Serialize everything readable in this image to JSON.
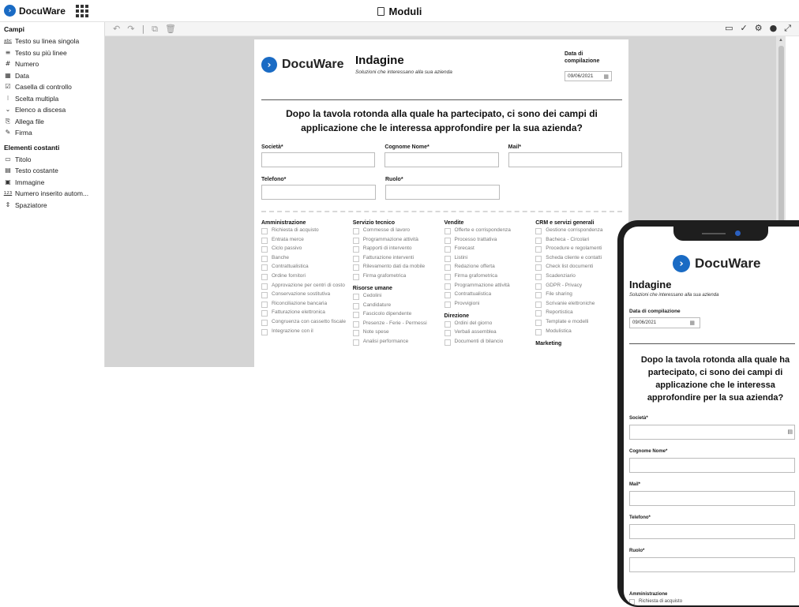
{
  "app": {
    "brand": "DocuWare",
    "title": "Moduli"
  },
  "sidebar": {
    "fields_heading": "Campi",
    "fields": [
      {
        "icon": "abc",
        "label": "Testo su linea singola"
      },
      {
        "icon": "≡",
        "label": "Testo su più linee"
      },
      {
        "icon": "#",
        "label": "Numero"
      },
      {
        "icon": "▦",
        "label": "Data"
      },
      {
        "icon": "☑",
        "label": "Casella di controllo"
      },
      {
        "icon": "⁝",
        "label": "Scelta multipla"
      },
      {
        "icon": "⌄",
        "label": "Elenco a discesa"
      },
      {
        "icon": "⎘",
        "label": "Allega file"
      },
      {
        "icon": "✎",
        "label": "Firma"
      }
    ],
    "constants_heading": "Elementi costanti",
    "constants": [
      {
        "icon": "▭",
        "label": "Titolo"
      },
      {
        "icon": "▤",
        "label": "Testo costante"
      },
      {
        "icon": "▣",
        "label": "Immagine"
      },
      {
        "icon": "123",
        "label": "Numero inserito autom..."
      },
      {
        "icon": "⇕",
        "label": "Spaziatore"
      }
    ]
  },
  "toolbar": {
    "left": [
      "↶",
      "↷",
      "|",
      "⧉",
      "🗑"
    ],
    "right": [
      "▭",
      "✓",
      "⚙",
      "●",
      "⤢"
    ]
  },
  "form": {
    "brand": "DocuWare",
    "title": "Indagine",
    "subtitle": "Soluzioni che interessano alla sua azienda",
    "date_label": "Data di compilazione",
    "date_value": "09/06/2021",
    "question": "Dopo la tavola rotonda alla quale ha partecipato, ci sono dei campi di applicazione che le interessa approfondire per la sua azienda?",
    "fields_row1": [
      "Società*",
      "Cognome Nome*",
      "Mail*"
    ],
    "fields_row2": [
      "Telefono*",
      "Ruolo*"
    ],
    "columns": [
      {
        "groups": [
          {
            "heading": "Amministrazione",
            "items": [
              "Richiesta di acquisto",
              "Entrata merce",
              "Ciclo passivo",
              "Banche",
              "Contrattualistica",
              "Ordine fornitori",
              "Approvazione per centri di costo",
              "Conservazione sostitutiva",
              "Riconciliazione bancaria",
              "Fatturazione elettronica",
              "Congruenza con cassetto fiscale",
              "Integrazione con il"
            ]
          }
        ]
      },
      {
        "groups": [
          {
            "heading": "Servizio tecnico",
            "items": [
              "Commesse di lavoro",
              "Programmazione attività",
              "Rapporti di intervento",
              "Fatturazione interventi",
              "Rilevamento dati da mobile",
              "Firma grafometrica"
            ]
          },
          {
            "heading": "Risorse umane",
            "items": [
              "Cedolini",
              "Candidature",
              "Fascicolo dipendente",
              "Presenze - Ferie - Permessi",
              "Note spese",
              "Analisi performance"
            ]
          }
        ]
      },
      {
        "groups": [
          {
            "heading": "Vendite",
            "items": [
              "Offerte e corrispondenza",
              "Processo trattativa",
              "Forecast",
              "Listini",
              "Redazione offerta",
              "Firma grafometrica",
              "Programmazione attività",
              "Contrattualistica",
              "Provvigioni"
            ]
          },
          {
            "heading": "Direzione",
            "items": [
              "Ordini del giorno",
              "Verbali assemblea",
              "Documenti di bilancio"
            ]
          }
        ]
      },
      {
        "groups": [
          {
            "heading": "CRM e servizi generali",
            "items": [
              "Gestione corrispondenza",
              "Bacheca - Circolari",
              "Procedure e regolamenti",
              "Scheda cliente e contatti",
              "Check list documenti",
              "Scadenziario",
              "GDPR - Privacy",
              "File sharing",
              "Scrivanie elettroniche",
              "Reportistica",
              "Template e modelli",
              "Modulistica"
            ]
          },
          {
            "heading": "Marketing",
            "items": []
          }
        ]
      }
    ]
  },
  "mobile": {
    "brand": "DocuWare",
    "title": "Indagine",
    "subtitle": "Soluzioni che interessano alla sua azienda",
    "date_label": "Data di compilazione",
    "date_value": "09/06/2021",
    "question": "Dopo la tavola rotonda alla quale ha partecipato, ci sono dei campi di applicazione che le interessa approfondire per la sua azienda?",
    "fields": [
      "Società*",
      "Cognome Nome*",
      "Mail*",
      "Telefono*",
      "Ruolo*"
    ],
    "section": "Amministrazione",
    "first_item": "Richiesta di acquisto"
  }
}
